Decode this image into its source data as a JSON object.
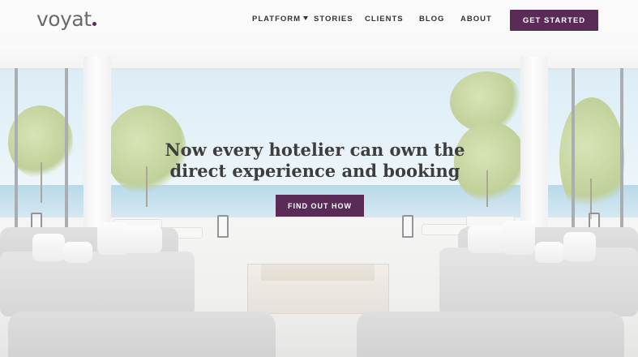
{
  "brand": {
    "logo_text": "voyat",
    "accent_color": "#5b2b57"
  },
  "nav": {
    "items": [
      {
        "label": "PLATFORM",
        "has_dropdown": true
      },
      {
        "label": "STORIES"
      },
      {
        "label": "CLIENTS"
      },
      {
        "label": "BLOG"
      },
      {
        "label": "ABOUT"
      }
    ],
    "cta_label": "GET STARTED"
  },
  "hero": {
    "headline_line1": "Now every hotelier can own the",
    "headline_line2": "direct experience and booking",
    "button_label": "FIND OUT HOW"
  },
  "icons": {
    "platform_dropdown": "chevron-down-icon"
  }
}
